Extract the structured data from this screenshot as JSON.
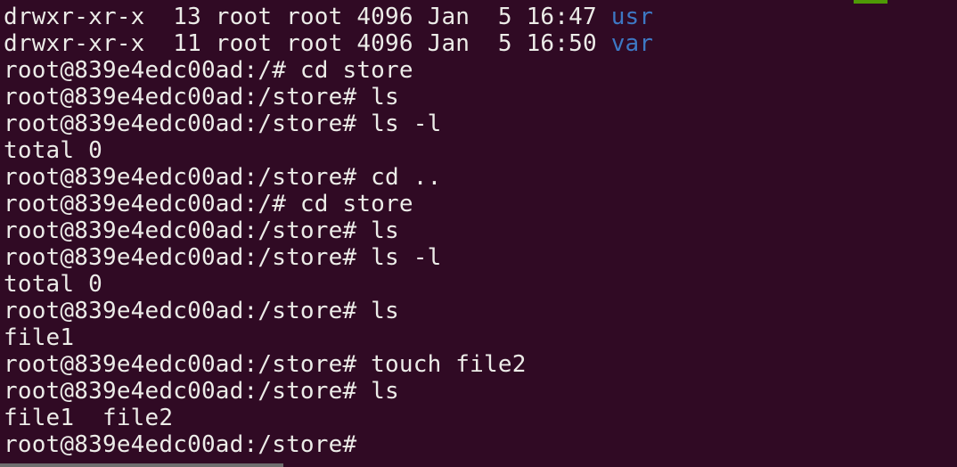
{
  "terminal": {
    "listing": [
      {
        "text": "drwxr-xr-x  13 root root 4096 Jan  5 16:47 ",
        "dir": "usr"
      },
      {
        "text": "drwxr-xr-x  11 root root 4096 Jan  5 16:50 ",
        "dir": "var"
      }
    ],
    "lines": [
      "root@839e4edc00ad:/# cd store",
      "root@839e4edc00ad:/store# ls",
      "root@839e4edc00ad:/store# ls -l",
      "total 0",
      "root@839e4edc00ad:/store# cd ..",
      "root@839e4edc00ad:/# cd store",
      "root@839e4edc00ad:/store# ls",
      "root@839e4edc00ad:/store# ls -l",
      "total 0",
      "root@839e4edc00ad:/store# ls",
      "file1",
      "root@839e4edc00ad:/store# touch file2",
      "root@839e4edc00ad:/store# ls",
      "file1  file2"
    ],
    "prompt": "root@839e4edc00ad:/store#",
    "colors": {
      "background": "#300a24",
      "text": "#ecece8",
      "directory": "#3d78c4"
    }
  }
}
